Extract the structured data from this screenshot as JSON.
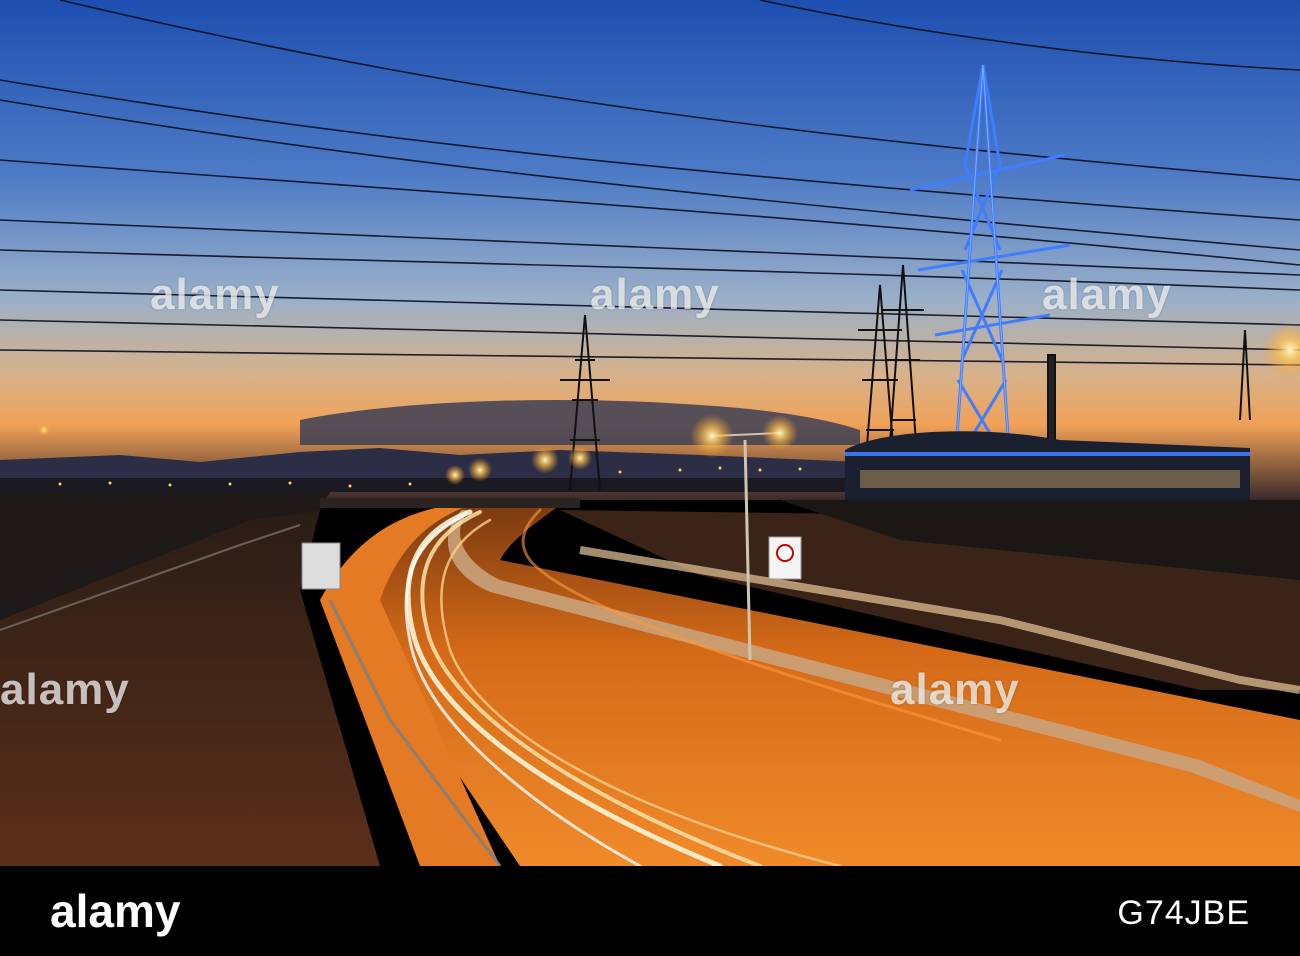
{
  "watermark": {
    "text": "alamy"
  },
  "footer": {
    "logo": "alamy",
    "image_id": "G74JBE"
  },
  "colors": {
    "sky_top": "#1f55b8",
    "sky_mid": "#6a8fc8",
    "horizon": "#e9a35a",
    "road": "#d96e1a",
    "pylon_blue": "#2f6bff",
    "streetlight": "#ffcf6a"
  }
}
